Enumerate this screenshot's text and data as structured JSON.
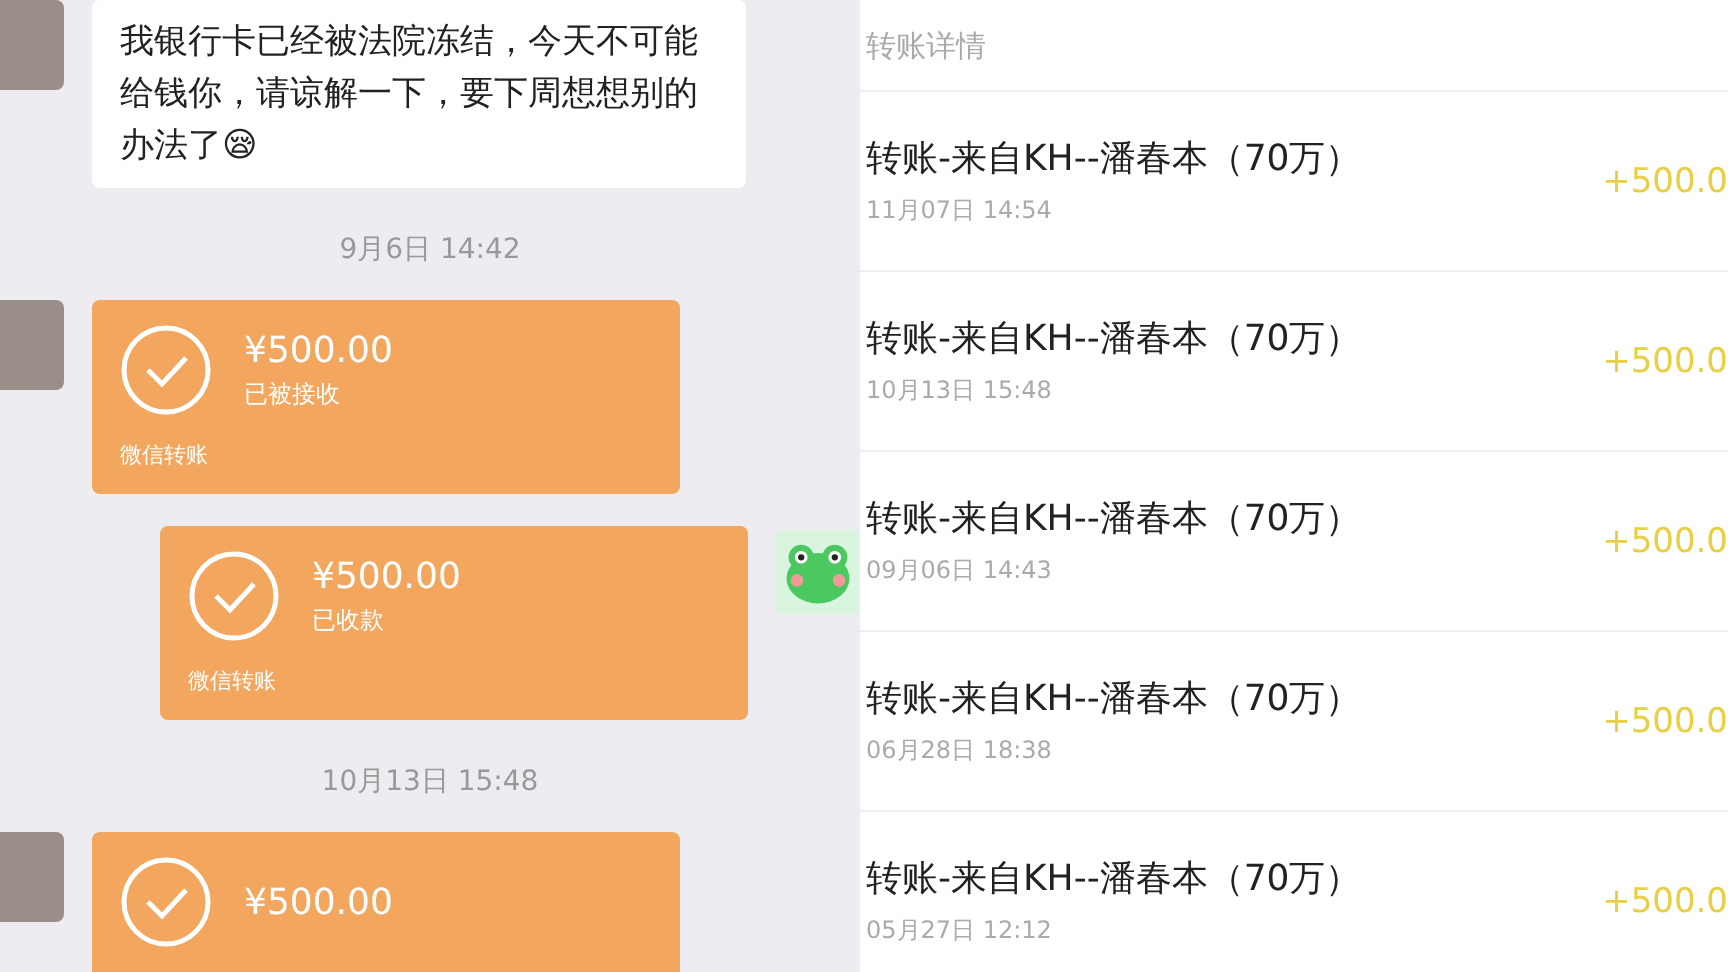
{
  "chat": {
    "messages": [
      {
        "kind": "text",
        "outgoing": false,
        "text": "我银行卡已经被法院冻结，今天不可能给钱你，请谅解一下，要下周想想别的办法了😪"
      },
      {
        "kind": "time",
        "text": "9月6日 14:42"
      },
      {
        "kind": "transfer",
        "outgoing": false,
        "amount": "¥500.00",
        "status": "已被接收",
        "footer": "微信转账"
      },
      {
        "kind": "transfer",
        "outgoing": true,
        "amount": "¥500.00",
        "status": "已收款",
        "footer": "微信转账"
      },
      {
        "kind": "time",
        "text": "10月13日 15:48"
      },
      {
        "kind": "transfer",
        "outgoing": false,
        "amount": "¥500.00"
      }
    ]
  },
  "transfer_details": {
    "title": "转账详情",
    "rows": [
      {
        "title": "转账-来自KH--潘春本（70万）",
        "date": "11月07日 14:54",
        "amount": "+500.0"
      },
      {
        "title": "转账-来自KH--潘春本（70万）",
        "date": "10月13日 15:48",
        "amount": "+500.0"
      },
      {
        "title": "转账-来自KH--潘春本（70万）",
        "date": "09月06日 14:43",
        "amount": "+500.0"
      },
      {
        "title": "转账-来自KH--潘春本（70万）",
        "date": "06月28日 18:38",
        "amount": "+500.0"
      },
      {
        "title": "转账-来自KH--潘春本（70万）",
        "date": "05月27日 12:12",
        "amount": "+500.0"
      }
    ]
  }
}
